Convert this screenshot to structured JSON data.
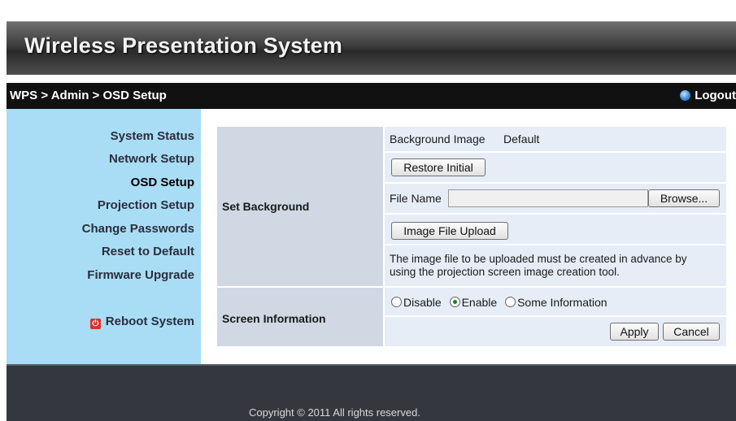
{
  "header": {
    "title": "Wireless Presentation System"
  },
  "navbar": {
    "breadcrumb": "WPS > Admin > OSD Setup",
    "logout": "Logout"
  },
  "sidebar": {
    "items": [
      {
        "label": "System Status"
      },
      {
        "label": "Network Setup"
      },
      {
        "label": "OSD Setup",
        "active": true
      },
      {
        "label": "Projection Setup"
      },
      {
        "label": "Change Passwords"
      },
      {
        "label": "Reset to Default"
      },
      {
        "label": "Firmware Upgrade"
      }
    ],
    "reboot": "Reboot System"
  },
  "set_background": {
    "label": "Set Background",
    "background_image_label": "Background Image",
    "background_image_value": "Default",
    "restore_button": "Restore Initial",
    "file_name_label": "File Name",
    "file_name_value": "",
    "browse_button": "Browse...",
    "upload_button": "Image File Upload",
    "note_line1": "The image file to be uploaded must be created in advance by",
    "note_line2": "using the projection screen image creation tool."
  },
  "screen_information": {
    "label": "Screen Information",
    "options": [
      "Disable",
      "Enable",
      "Some Information"
    ],
    "selected": "Enable",
    "apply_button": "Apply",
    "cancel_button": "Cancel"
  },
  "footer": {
    "copyright": "Copyright © 2011 All rights reserved."
  }
}
